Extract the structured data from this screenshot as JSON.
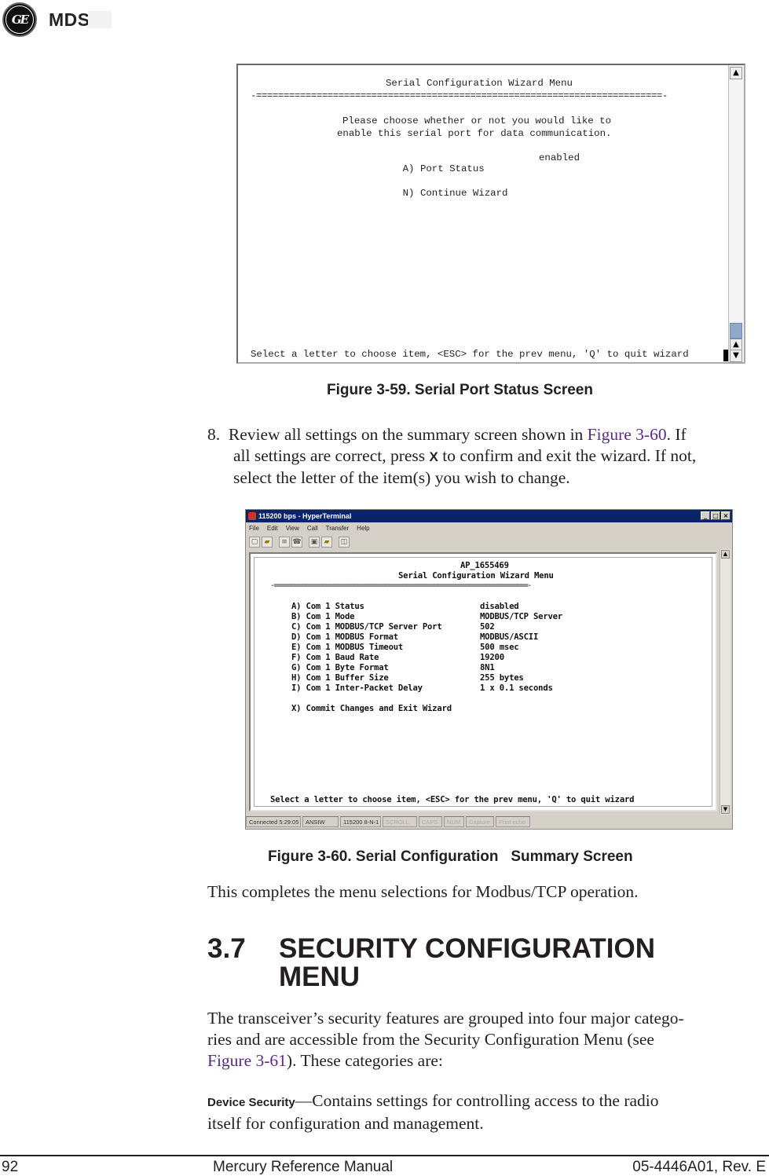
{
  "header": {
    "logo_mark": "GE",
    "logo_text": "MDS"
  },
  "figure_59": {
    "terminal": {
      "title": "Serial Configuration Wizard Menu",
      "rule": "-==========================================================================-",
      "prompt_line1": "Please choose whether or not you would like to",
      "prompt_line2": "enable this serial port for data communication.",
      "items": [
        {
          "key": "A)",
          "label": "Port Status",
          "value": "enabled"
        },
        {
          "key": "N)",
          "label": "Continue Wizard",
          "value": ""
        }
      ],
      "footer": "Select a letter to choose item, <ESC> for the prev menu, 'Q' to quit wizard"
    },
    "caption": "Figure 3-59. Serial Port Status Screen"
  },
  "step8": {
    "number": "8.",
    "text_1": "Review all settings on the summary screen shown in ",
    "link": "Figure 3-60",
    "text_2": ". If",
    "text_3": "all settings are correct, press ",
    "key": "X",
    "text_4": " to confirm and exit the wizard. If not,",
    "text_5": "select the letter of the item(s) you wish to change."
  },
  "figure_60": {
    "window": {
      "title": "115200 bps - HyperTerminal",
      "menu": [
        "File",
        "Edit",
        "View",
        "Call",
        "Transfer",
        "Help"
      ],
      "toolbar_icons": [
        "new-icon",
        "open-icon",
        "disconnect-icon",
        "properties-icon",
        "send-icon",
        "receive-icon",
        "settings-icon"
      ]
    },
    "terminal": {
      "device": "AP_1655469",
      "title": "Serial Configuration Wizard Menu",
      "rule": "-=========================================================================-",
      "items": [
        {
          "key": "A)",
          "label": "Com 1 Status",
          "value": "disabled"
        },
        {
          "key": "B)",
          "label": "Com 1 Mode",
          "value": "MODBUS/TCP Server"
        },
        {
          "key": "C)",
          "label": "Com 1 MODBUS/TCP Server Port",
          "value": "502"
        },
        {
          "key": "D)",
          "label": "Com 1 MODBUS Format",
          "value": "MODBUS/ASCII"
        },
        {
          "key": "E)",
          "label": "Com 1 MODBUS Timeout",
          "value": "500 msec"
        },
        {
          "key": "F)",
          "label": "Com 1 Baud Rate",
          "value": "19200"
        },
        {
          "key": "G)",
          "label": "Com 1 Byte Format",
          "value": "8N1"
        },
        {
          "key": "H)",
          "label": "Com 1 Buffer Size",
          "value": "255 bytes"
        },
        {
          "key": "I)",
          "label": "Com 1 Inter-Packet Delay",
          "value": "1 x 0.1 seconds"
        }
      ],
      "commit": {
        "key": "X)",
        "label": "Commit Changes and Exit Wizard"
      },
      "footer": "Select a letter to choose item, <ESC> for the prev menu, 'Q' to quit wizard"
    },
    "status_bar": [
      "Connected 5:29:05",
      "ANSIW",
      "115200 8-N-1",
      "SCROLL",
      "CAPS",
      "NUM",
      "Capture",
      "Print echo"
    ],
    "caption": "Figure 3-60. Serial Configuration   Summary Screen"
  },
  "paragraph_completes": "This completes the menu selections for Modbus/TCP operation.",
  "section": {
    "number": "3.7",
    "title_line1": "SECURITY CONFIGURATION",
    "title_line2": "MENU"
  },
  "intro": {
    "line1": "The transceiver’s security features are grouped into four major catego-",
    "line2": "ries and are accessible from the Security Configuration Menu (see",
    "link": "Figure 3-61",
    "line3_rest": "). These categories are:"
  },
  "device_security": {
    "term": "Device Security",
    "line1": "—Contains settings for controlling access to the radio",
    "line2": "itself for configuration and management."
  },
  "footer": {
    "page_number": "92",
    "manual_title": "Mercury Reference Manual",
    "doc_number": "05-4446A01, Rev. E"
  }
}
